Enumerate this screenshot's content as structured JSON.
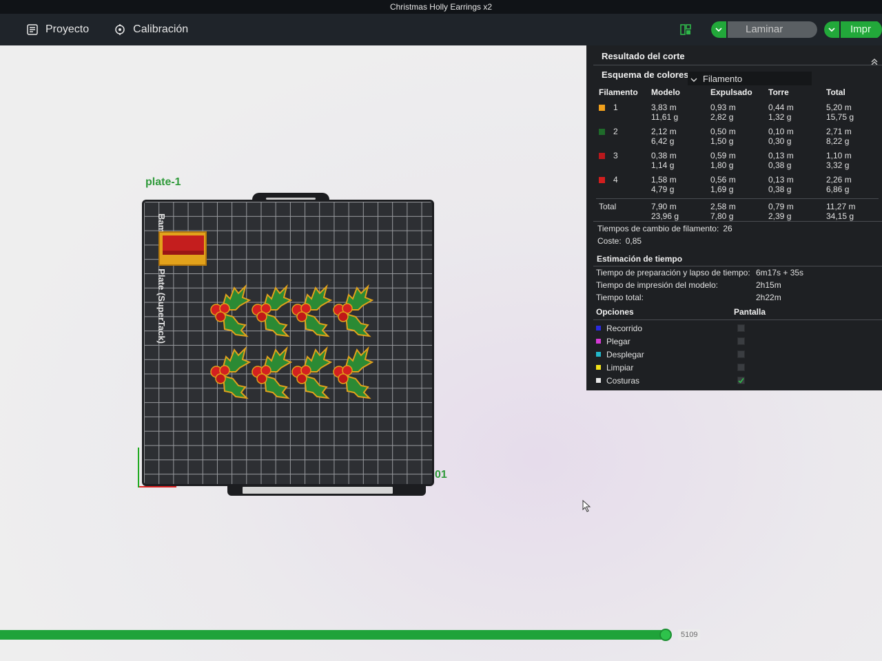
{
  "window": {
    "title": "Christmas Holly Earrings x2"
  },
  "menu": {
    "tabs": [
      {
        "label": "Proyecto",
        "icon": "project-icon"
      },
      {
        "label": "Calibración",
        "icon": "calibration-icon"
      }
    ],
    "slice_label": "Laminar placa",
    "print_label": "Impr"
  },
  "plate": {
    "name": "plate-1",
    "number": "01",
    "bed_text": "Bambu Cool Plate (SuperTack)",
    "objects": [
      "holly",
      "holly",
      "holly",
      "holly",
      "holly",
      "holly",
      "holly",
      "holly"
    ]
  },
  "panel": {
    "title": "Resultado del corte",
    "scheme_label": "Esquema de colores",
    "scheme_value": "Filamento",
    "columns": [
      "Filamento",
      "Modelo",
      "Expulsado",
      "Torre",
      "Total"
    ],
    "rows": [
      {
        "id": "1",
        "color": "#f0a01c",
        "modelo": [
          "3,83 m",
          "11,61 g"
        ],
        "expulsado": [
          "0,93 m",
          "2,82 g"
        ],
        "torre": [
          "0,44 m",
          "1,32 g"
        ],
        "total": [
          "5,20 m",
          "15,75 g"
        ]
      },
      {
        "id": "2",
        "color": "#1f6b2a",
        "modelo": [
          "2,12 m",
          "6,42 g"
        ],
        "expulsado": [
          "0,50 m",
          "1,50 g"
        ],
        "torre": [
          "0,10 m",
          "0,30 g"
        ],
        "total": [
          "2,71 m",
          "8,22 g"
        ]
      },
      {
        "id": "3",
        "color": "#b8181c",
        "modelo": [
          "0,38 m",
          "1,14 g"
        ],
        "expulsado": [
          "0,59 m",
          "1,80 g"
        ],
        "torre": [
          "0,13 m",
          "0,38 g"
        ],
        "total": [
          "1,10 m",
          "3,32 g"
        ]
      },
      {
        "id": "4",
        "color": "#d21e1e",
        "modelo": [
          "1,58 m",
          "4,79 g"
        ],
        "expulsado": [
          "0,56 m",
          "1,69 g"
        ],
        "torre": [
          "0,13 m",
          "0,38 g"
        ],
        "total": [
          "2,26 m",
          "6,86 g"
        ]
      }
    ],
    "total": {
      "label": "Total",
      "modelo": [
        "7,90 m",
        "23,96 g"
      ],
      "expulsado": [
        "2,58 m",
        "7,80 g"
      ],
      "torre": [
        "0,79 m",
        "2,39 g"
      ],
      "total": [
        "11,27 m",
        "34,15 g"
      ]
    },
    "changes_label": "Tiempos de cambio de filamento:",
    "changes_value": "26",
    "cost_label": "Coste:",
    "cost_value": "0,85",
    "time_title": "Estimación de tiempo",
    "time": [
      {
        "label": "Tiempo de preparación y lapso de tiempo:",
        "value": "6m17s + 35s"
      },
      {
        "label": "Tiempo de impresión del modelo:",
        "value": "2h15m"
      },
      {
        "label": "Tiempo total:",
        "value": "2h22m"
      }
    ],
    "options_label": "Opciones",
    "display_label": "Pantalla",
    "options": [
      {
        "name": "Recorrido",
        "color": "#2a2ae0",
        "checked": false
      },
      {
        "name": "Plegar",
        "color": "#d63ad6",
        "checked": false
      },
      {
        "name": "Desplegar",
        "color": "#22b7c9",
        "checked": false
      },
      {
        "name": "Limpiar",
        "color": "#f2e21a",
        "checked": false
      },
      {
        "name": "Costuras",
        "color": "#e8e8e8",
        "checked": true
      }
    ]
  },
  "slider": {
    "value": "5109",
    "fill": 0.755
  },
  "colors": {
    "accent": "#22a83a",
    "panel_bg": "#1e2023",
    "bed": "#2d2f33"
  }
}
